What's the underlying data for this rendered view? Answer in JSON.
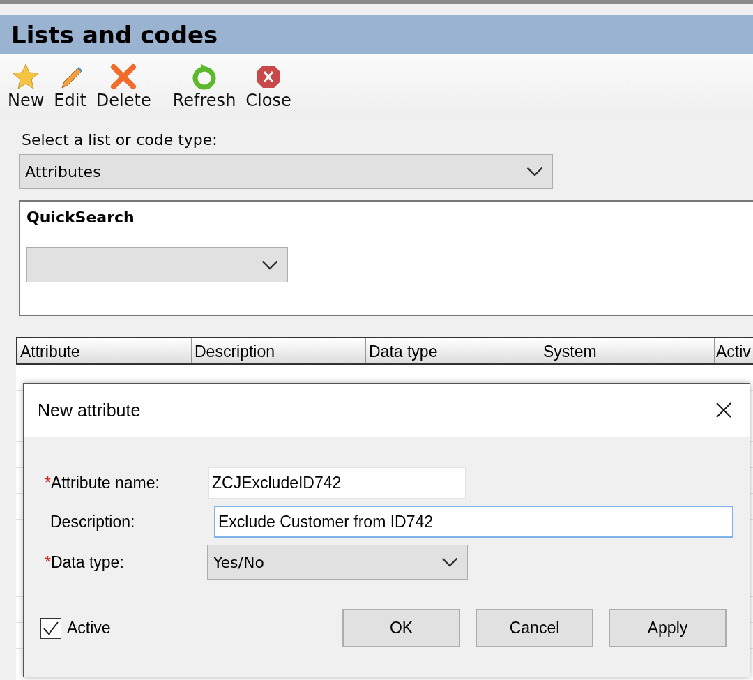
{
  "window": {
    "title": "Lists and codes"
  },
  "toolbar": [
    {
      "label": "New",
      "kind": "star"
    },
    {
      "label": "Edit",
      "kind": "pencil"
    },
    {
      "label": "Delete",
      "kind": "cross"
    },
    {
      "label": "Refresh",
      "kind": "refresh"
    },
    {
      "label": "Close",
      "kind": "close"
    }
  ],
  "type_select": {
    "label": "Select a list or code type:",
    "value": "Attributes"
  },
  "quick_search": {
    "title": "QuickSearch"
  },
  "table": {
    "columns": [
      "Attribute",
      "Description",
      "Data type",
      "System",
      "Activ"
    ]
  },
  "dialog": {
    "title": "New attribute",
    "fields": [
      {
        "marker": "*",
        "label": "Attribute name:",
        "kind": "text",
        "value": "ZCJExcludeID742",
        "focused": false
      },
      {
        "label": "Description:",
        "kind": "text",
        "value": "Exclude Customer from ID742",
        "focused": true
      },
      {
        "marker": "*",
        "label": "Data type:",
        "kind": "select",
        "value": "Yes/No"
      }
    ],
    "active": {
      "label": "Active",
      "checked": true
    },
    "buttons": [
      "OK",
      "Cancel",
      "Apply"
    ]
  }
}
